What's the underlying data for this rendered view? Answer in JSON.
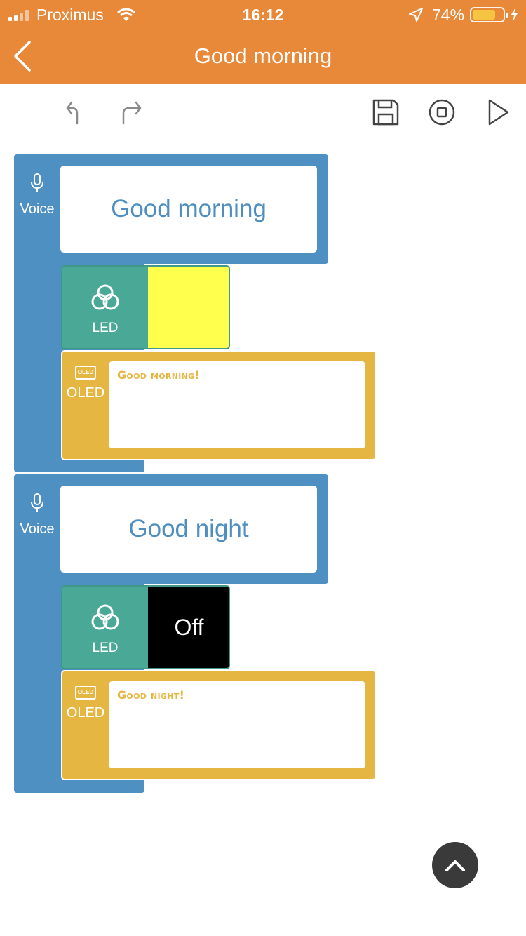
{
  "status_bar": {
    "carrier": "Proximus",
    "time": "16:12",
    "battery_percent": "74%",
    "battery_level": 0.74
  },
  "nav": {
    "title": "Good morning",
    "back_icon": "chevron-left-icon"
  },
  "toolbar": {
    "icons": [
      "undo-icon",
      "redo-icon",
      "save-icon",
      "stop-icon",
      "play-icon"
    ]
  },
  "blocks": [
    {
      "voice_label": "Voice",
      "voice_phrase": "Good morning",
      "led_label": "LED",
      "led_value": "",
      "led_color": "#ffff4d",
      "oled_label": "OLED",
      "oled_chip_text": "OLED",
      "oled_text": "Good morning!"
    },
    {
      "voice_label": "Voice",
      "voice_phrase": "Good night",
      "led_label": "LED",
      "led_value": "Off",
      "led_color": "#000000",
      "oled_label": "OLED",
      "oled_chip_text": "OLED",
      "oled_text": "Good night!"
    }
  ],
  "colors": {
    "header": "#e8893a",
    "voice_block": "#4f90c2",
    "led_block": "#4aa896",
    "oled_block": "#e6b642"
  }
}
